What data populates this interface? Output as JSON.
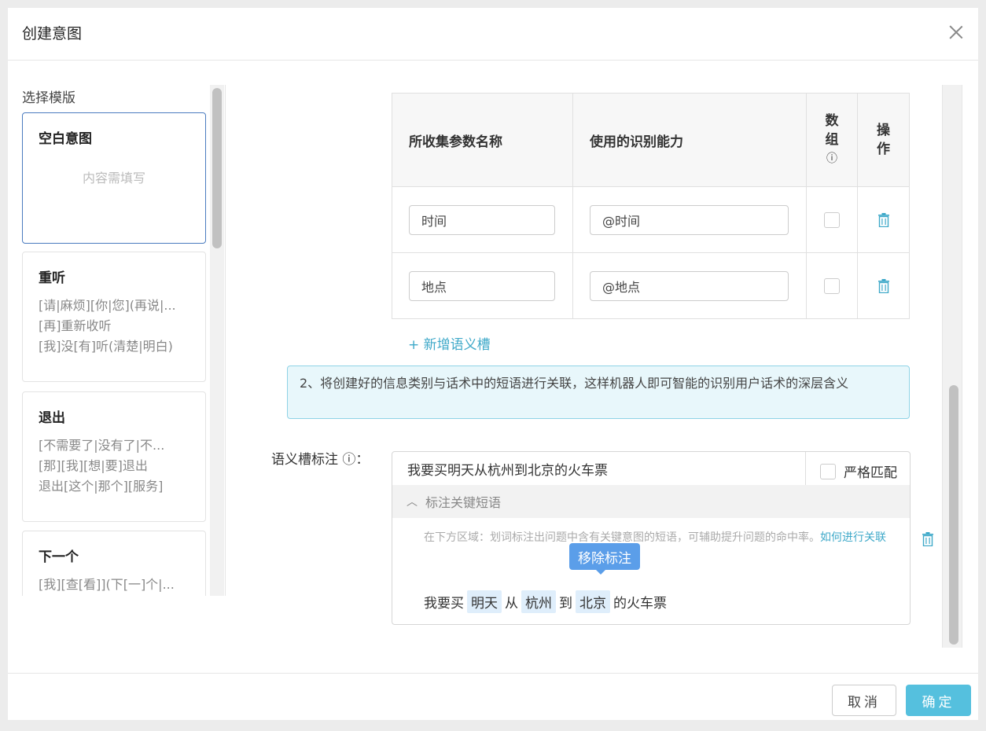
{
  "dialog": {
    "title": "创建意图"
  },
  "templates": {
    "label": "选择模版",
    "cards": [
      {
        "title": "空白意图",
        "placeholder": "内容需填写"
      },
      {
        "title": "重听",
        "lines": [
          "[请|麻烦][你|您](再说|...",
          "[再]重新收听",
          "[我]没[有]听(清楚|明白)"
        ]
      },
      {
        "title": "退出",
        "lines": [
          "[不需要了|没有了|不...",
          "[那][我][想|要]退出",
          "退出[这个|那个][服务]"
        ]
      },
      {
        "title": "下一个",
        "lines": [
          "[我][查[看]](下[一]个|..."
        ]
      }
    ]
  },
  "slot_table": {
    "headers": {
      "param_name": "所收集参数名称",
      "ability": "使用的识别能力",
      "array_line1": "数",
      "array_line2": "组",
      "array_info": "ⓘ",
      "action_line1": "操",
      "action_line2": "作"
    },
    "rows": [
      {
        "name": "时间",
        "ability": "@时间"
      },
      {
        "name": "地点",
        "ability": "@地点"
      }
    ],
    "add_label": "+ 新增语义槽"
  },
  "tip": {
    "text": "2、将创建好的信息类别与话术中的短语进行关联，这样机器人即可智能的识别用户话术的深层含义"
  },
  "annotation": {
    "label": "语义槽标注 ⓘ：",
    "sentence": "我要买明天从杭州到北京的火车票",
    "strict_label": "严格匹配",
    "collapse_label": "标注关键短语",
    "hint_text": "在下方区域：划词标注出问题中含有关键意图的短语，可辅助提升问题的命中率。",
    "hint_link": "如何进行关联",
    "tooltip": "移除标注",
    "segments": {
      "s1": "我要买",
      "t1": "明天",
      "s2": "从",
      "t2": "杭州",
      "s3": "到",
      "t3": "北京",
      "s4": "的火车票"
    }
  },
  "footer": {
    "cancel": "取消",
    "confirm": "确定"
  },
  "colors": {
    "accent": "#3fa9c9",
    "confirm_button": "#55c0de",
    "tooltip": "#5b9ee9",
    "tag_bg": "#dfeefb",
    "tip_bg": "#e8f7fb"
  }
}
